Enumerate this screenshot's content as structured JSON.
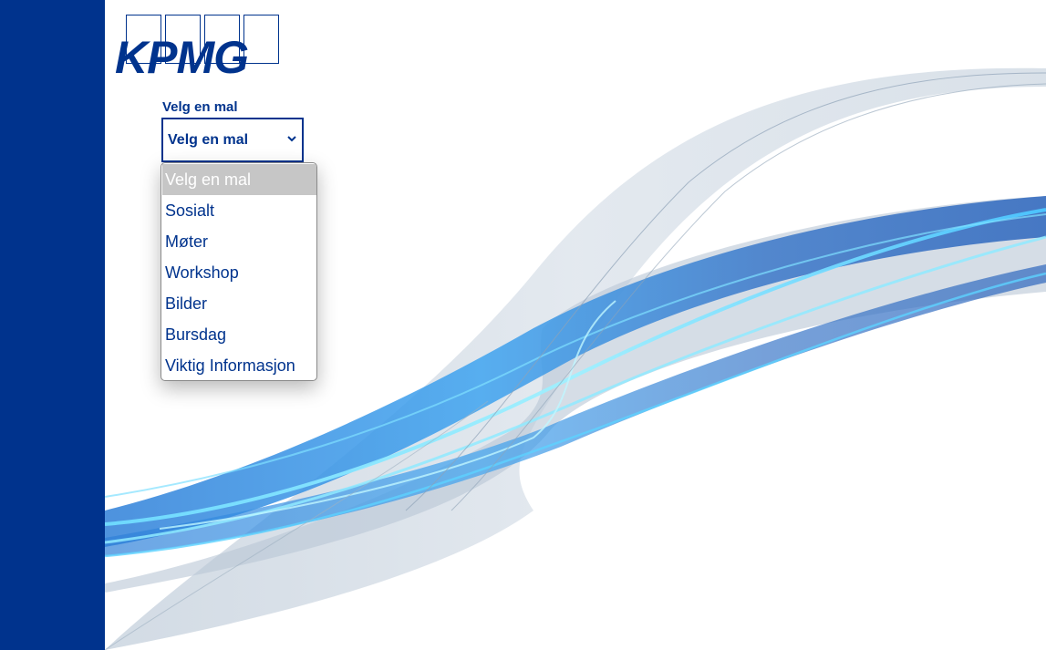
{
  "brand": {
    "logo_text": "KPMG",
    "primary_color": "#00338d"
  },
  "template_picker": {
    "label": "Velg en mal",
    "selected_value": "Velg en mal",
    "options": [
      "Velg en mal",
      "Sosialt",
      "Møter",
      "Workshop",
      "Bilder",
      "Bursdag",
      "Viktig Informasjon"
    ],
    "highlighted_option": "Velg en mal"
  },
  "icons": {
    "select_chevron": "chevron-down-icon"
  }
}
